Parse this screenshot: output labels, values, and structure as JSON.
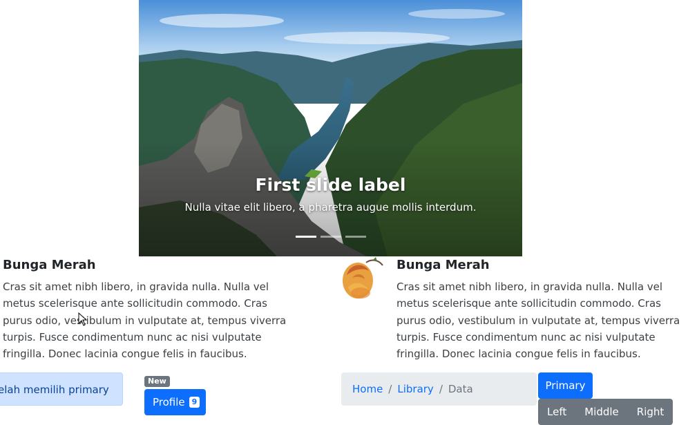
{
  "carousel": {
    "caption_title": "First slide label",
    "caption_text": "Nulla vitae elit libero, a pharetra augue mollis interdum.",
    "indicators": 3,
    "active_index": 0
  },
  "media_left": {
    "title": "Bunga Merah",
    "text": "Cras sit amet nibh libero, in gravida nulla. Nulla vel metus scelerisque ante sollicitudin commodo. Cras purus odio, vestibulum in vulputate at, tempus viverra turpis. Fusce condimentum nunc ac nisi vulputate fringilla. Donec lacinia congue felis in faucibus."
  },
  "media_right": {
    "title": "Bunga Merah",
    "text": "Cras sit amet nibh libero, in gravida nulla. Nulla vel metus scelerisque ante sollicitudin commodo. Cras purus odio, vestibulum in vulputate at, tempus viverra turpis. Fusce condimentum nunc ac nisi vulputate fringilla. Donec lacinia congue felis in faucibus.",
    "image": "rose-flower-image"
  },
  "alert": {
    "text": "elah memilih primary"
  },
  "profile": {
    "badge": "New",
    "label": "Profile",
    "count": "9"
  },
  "breadcrumb": {
    "home": "Home",
    "library": "Library",
    "data": "Data",
    "separator": "/"
  },
  "buttons": {
    "primary": "Primary",
    "left": "Left",
    "middle": "Middle",
    "right": "Right"
  },
  "colors": {
    "primary": "#0d6efd",
    "secondary": "#6c757d",
    "alert_bg": "#cfe2ff",
    "breadcrumb_bg": "#e9ecef"
  }
}
